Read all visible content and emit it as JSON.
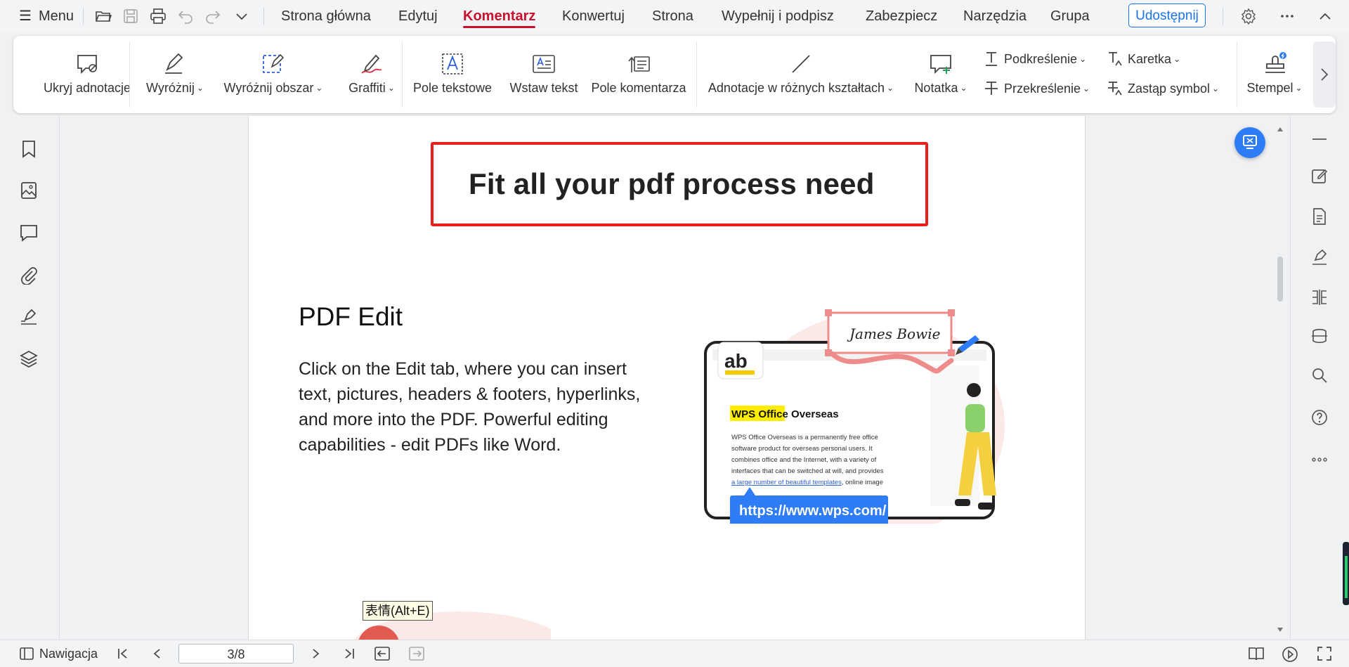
{
  "menubar": {
    "menu_label": "Menu",
    "tabs": [
      {
        "label": "Strona główna"
      },
      {
        "label": "Edytuj"
      },
      {
        "label": "Komentarz",
        "active": true
      },
      {
        "label": "Konwertuj"
      },
      {
        "label": "Strona"
      },
      {
        "label": "Wypełnij i podpisz"
      },
      {
        "label": "Zabezpiecz"
      },
      {
        "label": "Narzędzia"
      },
      {
        "label": "Grupa"
      }
    ],
    "share_label": "Udostępnij",
    "quick_access_icons": [
      "open-folder-icon",
      "save-icon",
      "print-icon",
      "undo-icon",
      "redo-icon",
      "chevron-down-icon"
    ],
    "right_icons": [
      "settings-icon",
      "more-icon",
      "collapse-icon"
    ],
    "active_color": "#c8102e",
    "accent_color": "#1a73e8"
  },
  "ribbon": {
    "hide_annotations": "Ukryj adnotacje",
    "highlight": "Wyróżnij",
    "area_highlight": "Wyróżnij obszar",
    "graffiti": "Graffiti",
    "text_box": "Pole tekstowe",
    "insert_text": "Wstaw tekst",
    "comment_box": "Pole komentarza",
    "shapes": "Adnotacje w różnych kształtach",
    "note": "Notatka",
    "underline": "Podkreślenie",
    "strikethrough": "Przekreślenie",
    "caret": "Karetka",
    "replace_symbol": "Zastąp symbol",
    "stamp": "Stempel"
  },
  "sidebar_left": {
    "icons": [
      "bookmark-icon",
      "image-icon",
      "comment-icon",
      "attachment-icon",
      "signature-icon",
      "layers-icon"
    ]
  },
  "document": {
    "headline": "Fit all your pdf process need",
    "section_title": "PDF Edit",
    "section_body": "Click on the Edit tab, where you can insert text, pictures, headers & footers, hyperlinks, and more into the PDF. Powerful editing capabilities - edit PDFs like Word.",
    "illustration": {
      "ab_label": "ab",
      "signature_text": "James Bowie",
      "doc_title_highlight": "WPS Office",
      "doc_title_rest": " Overseas",
      "doc_lines": [
        "WPS Office Overseas is a permanently free office",
        "software product for overseas personal users. It",
        "combines office and the Internet, with a variety of",
        "interfaces that can be switched at will, and provides"
      ],
      "doc_link_text": "a large number of beautiful templates",
      "doc_link_tail": ", online image",
      "url": "https://www.wps.com/"
    },
    "tooltip": "表情(Alt+E)",
    "box_color": "#e7201e"
  },
  "sidebar_right": {
    "icons": [
      "minus-icon",
      "edit-icon",
      "document-convert-icon",
      "pen-sign-icon",
      "compare-icon",
      "scan-icon",
      "search-icon",
      "help-icon",
      "more-icon"
    ]
  },
  "statusbar": {
    "navigation": "Nawigacja",
    "page_value": "3/8"
  }
}
